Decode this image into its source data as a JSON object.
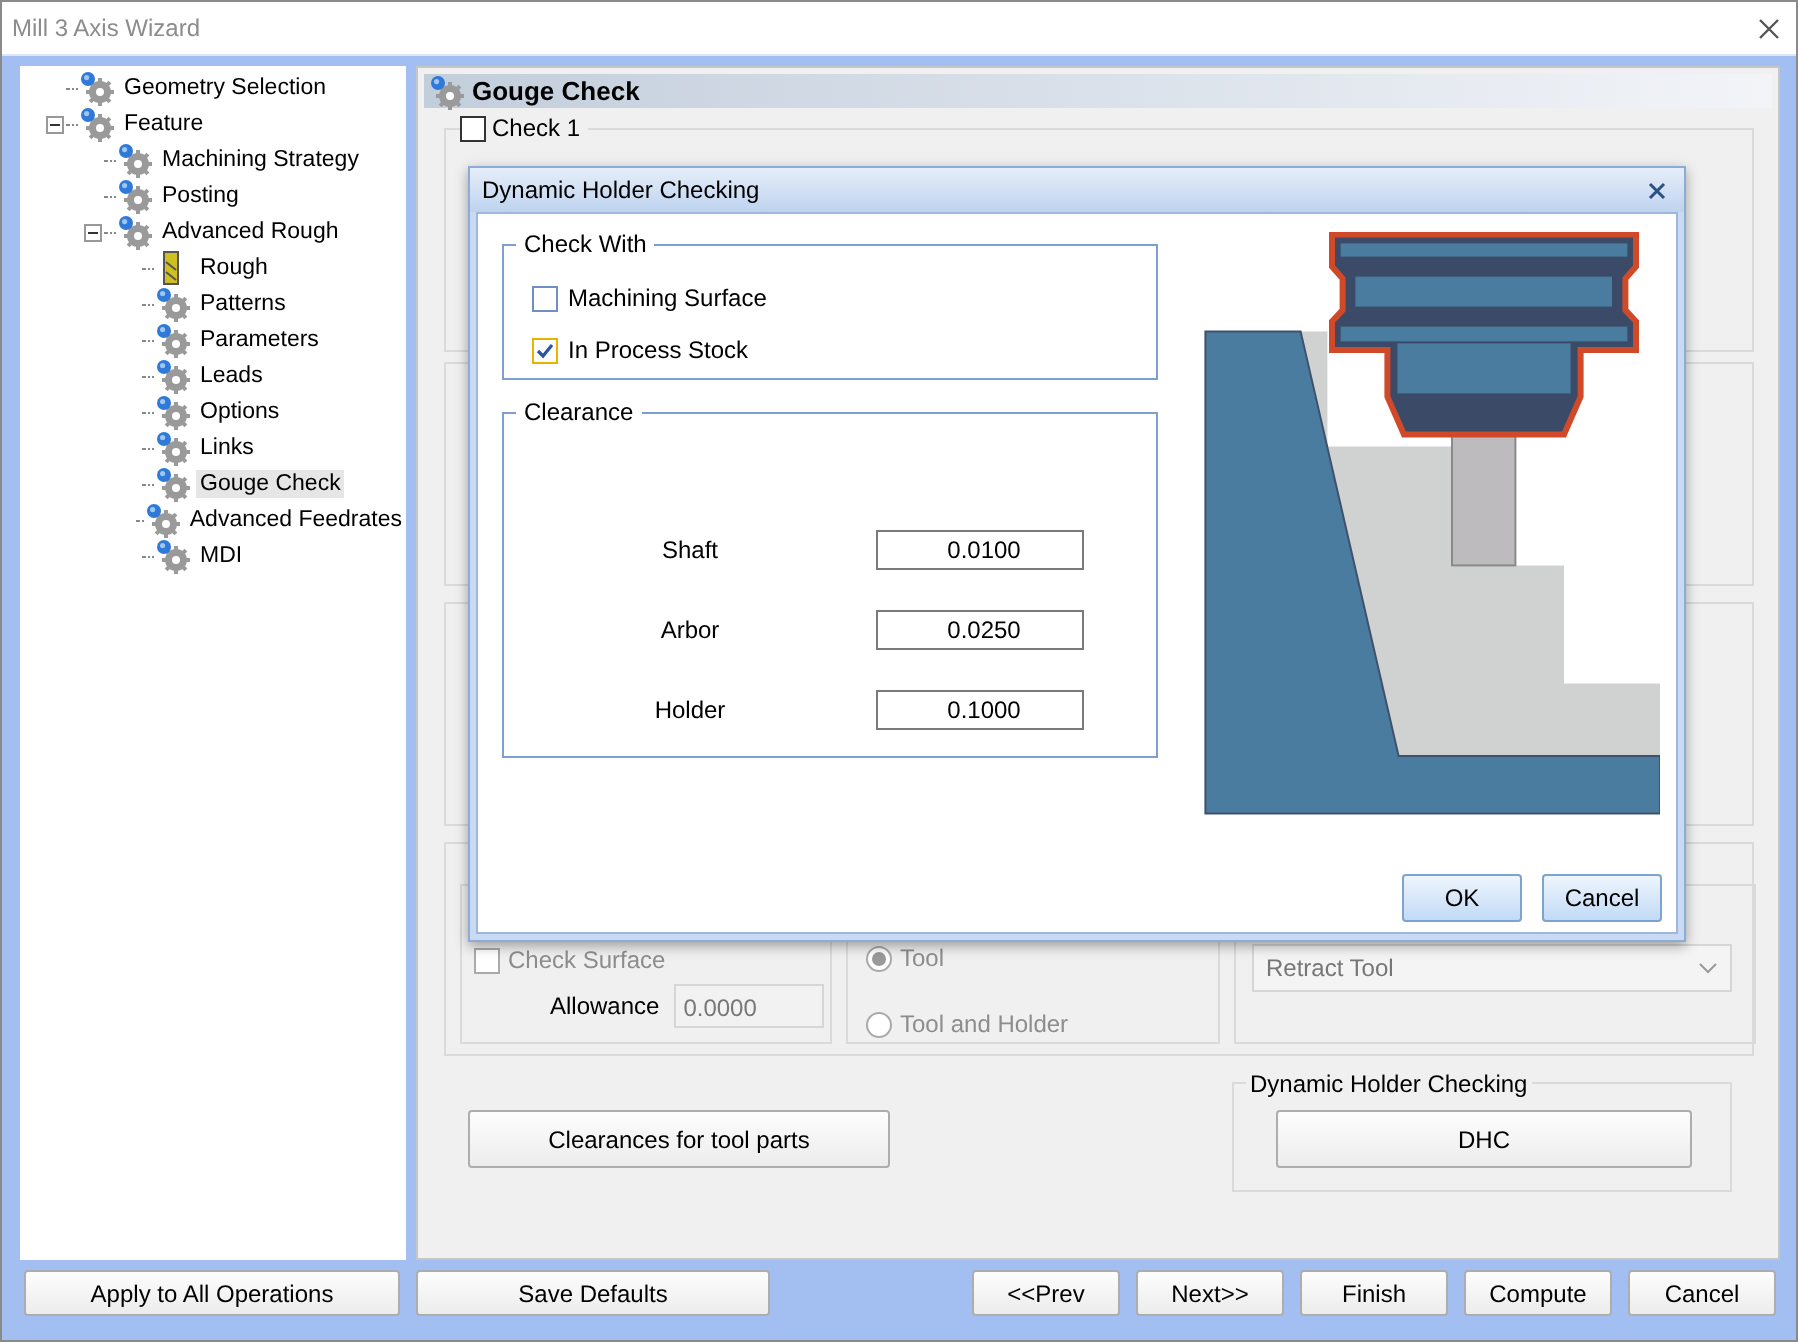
{
  "window": {
    "title": "Mill 3 Axis Wizard"
  },
  "tree": [
    {
      "label": "Geometry Selection",
      "kind": "gear",
      "selected": false
    },
    {
      "label": "Feature",
      "kind": "gear",
      "selected": false,
      "expanded": true,
      "children": [
        {
          "label": "Machining Strategy",
          "kind": "gear",
          "selected": false
        },
        {
          "label": "Posting",
          "kind": "gear",
          "selected": false
        },
        {
          "label": "Advanced Rough",
          "kind": "gear",
          "selected": false,
          "expanded": true,
          "children": [
            {
              "label": "Rough",
              "kind": "tool",
              "selected": false
            },
            {
              "label": "Patterns",
              "kind": "gear",
              "selected": false
            },
            {
              "label": "Parameters",
              "kind": "gear",
              "selected": false
            },
            {
              "label": "Leads",
              "kind": "gear",
              "selected": false
            },
            {
              "label": "Options",
              "kind": "gear",
              "selected": false
            },
            {
              "label": "Links",
              "kind": "gear",
              "selected": false
            },
            {
              "label": "Gouge Check",
              "kind": "gear",
              "selected": true
            },
            {
              "label": "Advanced Feedrates",
              "kind": "gear",
              "selected": false
            },
            {
              "label": "MDI",
              "kind": "gear",
              "selected": false
            }
          ]
        }
      ]
    }
  ],
  "panel": {
    "title": "Gouge Check",
    "check_group": {
      "label": "Check 1",
      "checked": false
    },
    "check_surface": {
      "label": "Check Surface",
      "checked": false,
      "disabled": true
    },
    "allowance": {
      "label": "Allowance",
      "value": "0.0000"
    },
    "radios": [
      {
        "label": "Tool",
        "selected": true,
        "disabled": true
      },
      {
        "label": "Tool and Holder",
        "selected": false,
        "disabled": true
      }
    ],
    "retract": {
      "value": "Retract Tool"
    },
    "clearances_button": "Clearances for tool parts",
    "dhc_group": {
      "title": "Dynamic Holder Checking",
      "button": "DHC"
    }
  },
  "dialog": {
    "title": "Dynamic Holder Checking",
    "check_with": {
      "title": "Check With",
      "options": [
        {
          "label": "Machining Surface",
          "checked": false
        },
        {
          "label": "In Process Stock",
          "checked": true
        }
      ]
    },
    "clearance": {
      "title": "Clearance",
      "fields": [
        {
          "label": "Shaft",
          "value": "0.0100"
        },
        {
          "label": "Arbor",
          "value": "0.0250"
        },
        {
          "label": "Holder",
          "value": "0.1000"
        }
      ]
    },
    "buttons": [
      "OK",
      "Cancel"
    ]
  },
  "footer": {
    "left": [
      "Apply to All Operations",
      "Save Defaults"
    ],
    "right": [
      "<<Prev",
      "Next>>",
      "Finish",
      "Compute",
      "Cancel"
    ]
  }
}
